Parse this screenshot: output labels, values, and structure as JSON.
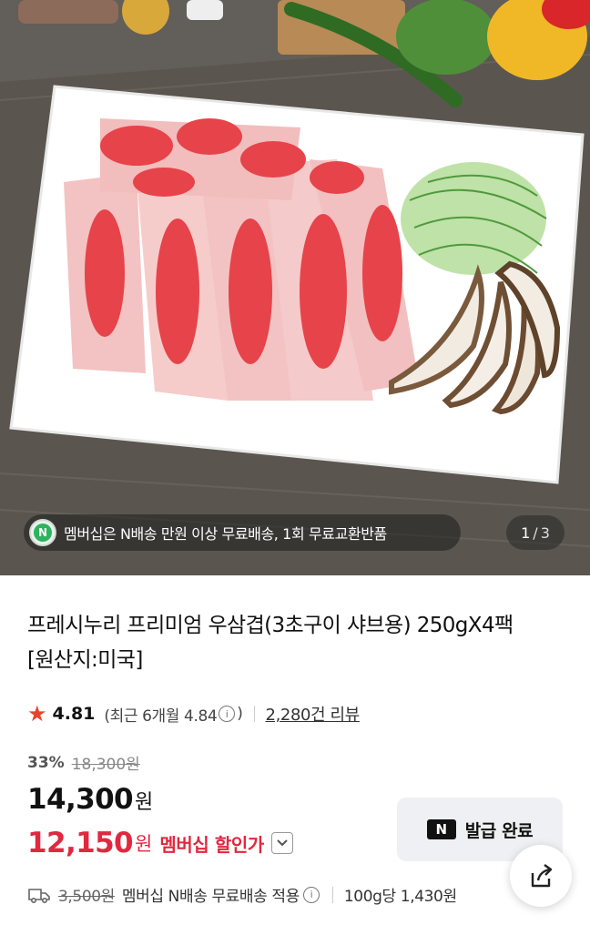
{
  "image": {
    "promo_badge_icon": "n-membership-icon",
    "promo_badge_letter": "N",
    "promo_text": "멤버십은 N배송 만원 이상 무료배송, 1회 무료교환반품",
    "counter_current": "1",
    "counter_separator": "/",
    "counter_total": "3"
  },
  "product": {
    "title": "프레시누리 프리미엄 우삼겹(3초구이 샤브용) 250gX4팩 [원산지:미국]"
  },
  "rating": {
    "star_icon": "star-icon",
    "score": "4.81",
    "recent_label": "(최근 6개월 4.84",
    "recent_close": ")",
    "info_icon": "i",
    "review_count": "2,280건 리뷰"
  },
  "price": {
    "discount_rate": "33%",
    "original": "18,300원",
    "sale_amount": "14,300",
    "sale_unit": "원",
    "member_amount": "12,150",
    "member_unit": "원",
    "member_label": "멤버십 할인가"
  },
  "coupon": {
    "logo_letter": "N",
    "label": "발급 완료"
  },
  "shipping": {
    "icon": "truck-icon",
    "original_fee": "3,500원",
    "text": "멤버십 N배송 무료배송 적용",
    "info_icon": "i",
    "unit_price": "100g당 1,430원"
  },
  "colors": {
    "accent_red": "#e1283f",
    "star": "#e8432e",
    "naver_green": "#2db35d"
  }
}
